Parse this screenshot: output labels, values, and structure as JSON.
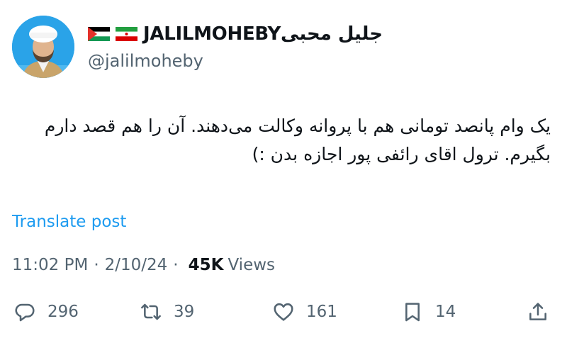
{
  "author": {
    "flags": [
      "palestine-flag-icon",
      "iran-flag-icon"
    ],
    "display_name": "JALILMOHEBYجلیل محبی",
    "handle": "@jalilmoheby"
  },
  "tweet": {
    "text": "یک وام پانصد تومانی هم با پروانه وکالت می‌دهند. آن را هم قصد دارم بگیرم. ترول اقای رائفی پور اجازه بدن :)",
    "translate_label": "Translate post"
  },
  "meta": {
    "time": "11:02 PM",
    "date": "2/10/24",
    "views_count": "45K",
    "views_label": "Views"
  },
  "actions": {
    "replies": "296",
    "reposts": "39",
    "likes": "161",
    "bookmarks": "14"
  },
  "colors": {
    "accent": "#1d9bf0",
    "secondary_text": "#536471",
    "primary_text": "#0f1419"
  }
}
